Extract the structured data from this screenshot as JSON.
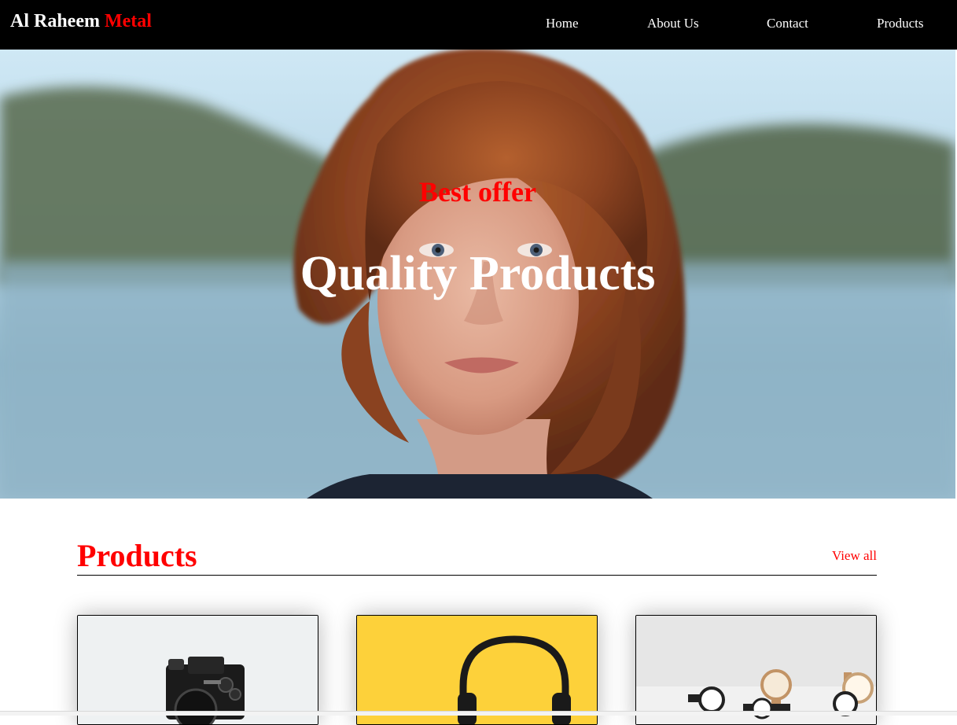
{
  "navbar": {
    "brand": {
      "part1": "Al Raheem ",
      "part2": "Metal"
    },
    "links": [
      {
        "label": "Home"
      },
      {
        "label": "About Us"
      },
      {
        "label": "Contact"
      },
      {
        "label": "Products"
      }
    ]
  },
  "hero": {
    "eyebrow": "Best offer",
    "title": "Quality Products"
  },
  "products": {
    "title": "Products",
    "view_all": "View all",
    "cards": [
      {
        "image": "camera-photo"
      },
      {
        "image": "headphones-photo"
      },
      {
        "image": "watches-photo"
      }
    ]
  },
  "colors": {
    "navbar_bg": "#000000",
    "accent": "#ff0000",
    "text_light": "#ffffff"
  }
}
